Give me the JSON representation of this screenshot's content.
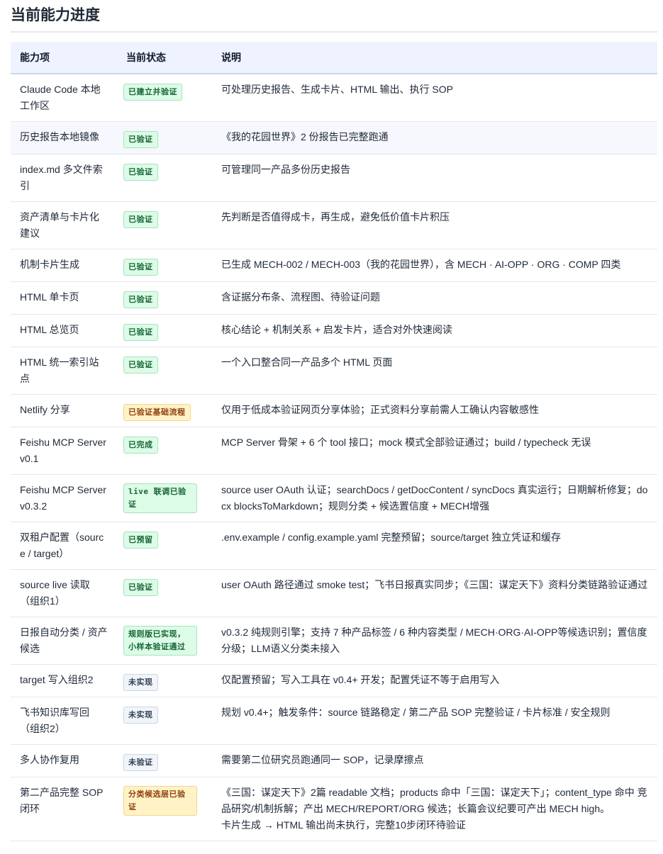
{
  "page": {
    "title": "当前能力进度"
  },
  "table": {
    "headers": [
      "能力项",
      "当前状态",
      "说明"
    ],
    "rows": [
      {
        "item": "Claude Code 本地工作区",
        "status": "已建立并验证",
        "tone": "green",
        "note": "可处理历史报告、生成卡片、HTML 输出、执行 SOP"
      },
      {
        "item": "历史报告本地镜像",
        "status": "已验证",
        "tone": "green",
        "note": "《我的花园世界》2 份报告已完整跑通"
      },
      {
        "item": "index.md 多文件索引",
        "status": "已验证",
        "tone": "green",
        "note": "可管理同一产品多份历史报告"
      },
      {
        "item": "资产清单与卡片化建议",
        "status": "已验证",
        "tone": "green",
        "note": "先判断是否值得成卡，再生成，避免低价值卡片积压"
      },
      {
        "item": "机制卡片生成",
        "status": "已验证",
        "tone": "green",
        "note": "已生成 MECH-002 / MECH-003（我的花园世界），含 MECH · AI-OPP · ORG · COMP 四类"
      },
      {
        "item": "HTML 单卡页",
        "status": "已验证",
        "tone": "green",
        "note": "含证据分布条、流程图、待验证问题"
      },
      {
        "item": "HTML 总览页",
        "status": "已验证",
        "tone": "green",
        "note": "核心结论 + 机制关系 + 启发卡片，适合对外快速阅读"
      },
      {
        "item": "HTML 统一索引站点",
        "status": "已验证",
        "tone": "green",
        "note": "一个入口整合同一产品多个 HTML 页面"
      },
      {
        "item": "Netlify 分享",
        "status": "已验证基础流程",
        "tone": "yellow",
        "note": "仅用于低成本验证网页分享体验；正式资料分享前需人工确认内容敏感性"
      },
      {
        "item": "Feishu MCP Server v0.1",
        "status": "已完成",
        "tone": "green",
        "note": "MCP Server 骨架 + 6 个 tool 接口；mock 模式全部验证通过；build / typecheck 无误"
      },
      {
        "item": "Feishu MCP Server v0.3.2",
        "status": "live 联调已验证",
        "tone": "green",
        "note": "source user OAuth 认证；searchDocs / getDocContent / syncDocs 真实运行；日期解析修复；docx blocksToMarkdown；规则分类 + 候选置信度 + MECH增强"
      },
      {
        "item": "双租户配置（source / target）",
        "status": "已预留",
        "tone": "green",
        "note": ".env.example / config.example.yaml 完整预留；source/target 独立凭证和缓存"
      },
      {
        "item": "source live 读取（组织1）",
        "status": "已验证",
        "tone": "green",
        "note": "user OAuth 路径通过 smoke test；飞书日报真实同步；《三国：谋定天下》资料分类链路验证通过"
      },
      {
        "item": "日报自动分类 / 资产候选",
        "status": "规则版已实现，小样本验证通过",
        "tone": "green",
        "note": "v0.3.2 纯规则引擎；支持 7 种产品标签 / 6 种内容类型 / MECH·ORG·AI-OPP等候选识别；置信度分级；LLM语义分类未接入"
      },
      {
        "item": "target 写入组织2",
        "status": "未实现",
        "tone": "gray",
        "note": "仅配置预留；写入工具在 v0.4+ 开发；配置凭证不等于启用写入"
      },
      {
        "item": "飞书知识库写回（组织2）",
        "status": "未实现",
        "tone": "gray",
        "note": "规划 v0.4+；触发条件：source 链路稳定 / 第二产品 SOP 完整验证 / 卡片标准 / 安全规则"
      },
      {
        "item": "多人协作复用",
        "status": "未验证",
        "tone": "gray",
        "note": "需要第二位研究员跑通同一 SOP，记录摩擦点"
      },
      {
        "item": "第二产品完整 SOP 闭环",
        "status": "分类候选层已验证",
        "tone": "yellow",
        "note": "《三国：谋定天下》2篇 readable 文档；products 命中「三国：谋定天下」；content_type 命中 竞品研究/机制拆解；产出 MECH/REPORT/ORG 候选；长篇会议纪要可产出 MECH high。",
        "note2": "卡片生成 → HTML 输出尚未执行，完整10步闭环待验证"
      }
    ]
  }
}
